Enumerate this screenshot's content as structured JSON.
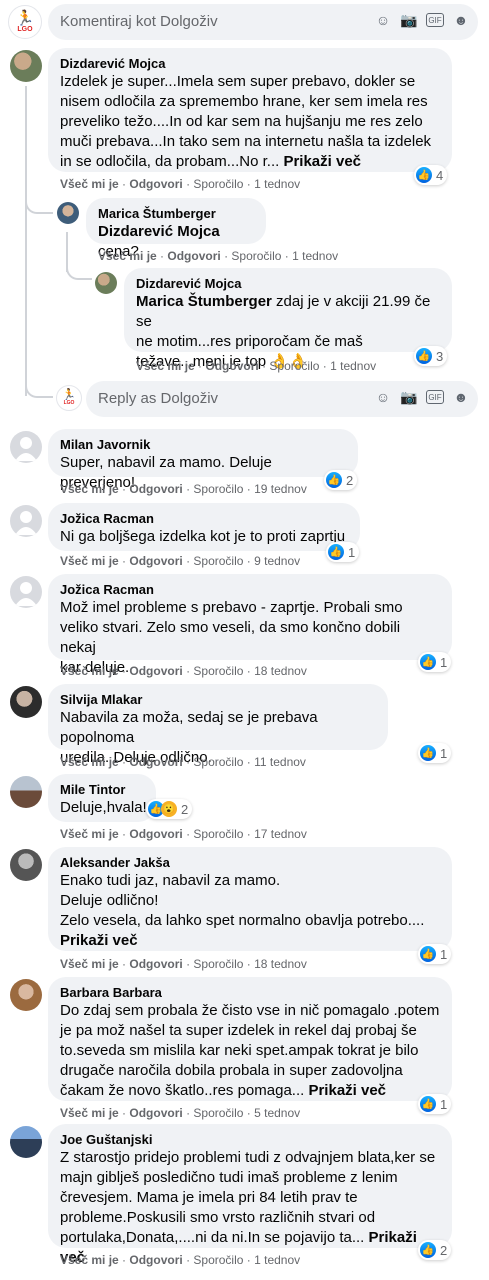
{
  "page_name": "Dolgoživ",
  "top_composer": {
    "placeholder": "Komentiraj kot Dolgoživ"
  },
  "reply_composer": {
    "placeholder": "Reply as Dolgoživ"
  },
  "logo": {
    "text": "LGO"
  },
  "actions": {
    "like": "Všeč mi je",
    "reply": "Odgovori",
    "message": "Sporočilo",
    "sep": " · "
  },
  "more_label": "Prikaži več",
  "comments": [
    {
      "name": "Dizdarević Mojca",
      "lines": [
        "Izdelek je super...Imela sem super prebavo, dokler se",
        "nisem odločila za spremembo hrane, ker sem imela res",
        "preveliko težo....In od kar sem na hujšanju me res zelo",
        "muči prebava...In tako sem na internetu našla ta izdelek",
        "in se odločila, da probam...No r..."
      ],
      "more": true,
      "time": "1 tednov",
      "reactions": "4"
    },
    {
      "name": "Marica Štumberger",
      "mention": "Dizdarević Mojca",
      "lines": [
        " cena?"
      ],
      "time": "1 tednov",
      "reactions": ""
    },
    {
      "name": "Dizdarević Mojca",
      "mention": "Marica Štumberger",
      "lines": [
        " zdaj je v akciji 21.99 če se",
        "ne motim...res priporočam če maš",
        "težave...meni je top 👌👌"
      ],
      "time": "1 tednov",
      "reactions": "3"
    },
    {
      "name": "Milan Javornik",
      "lines": [
        "Super, nabavil za mamo. Deluje preverjeno!"
      ],
      "time": "19 tednov",
      "reactions": "2"
    },
    {
      "name": "Jožica Racman",
      "lines": [
        "Ni ga boljšega izdelka kot je to proti zaprtju"
      ],
      "time": "9 tednov",
      "reactions": "1"
    },
    {
      "name": "Jožica Racman",
      "lines": [
        "Mož imel probleme s prebavo - zaprtje. Probali smo",
        "veliko stvari. Zelo smo veseli, da smo končno dobili nekaj",
        "kar deluje."
      ],
      "time": "18 tednov",
      "reactions": "1"
    },
    {
      "name": "Silvija Mlakar",
      "lines": [
        "Nabavila za moža, sedaj se je prebava popolnoma",
        "uredila. Deluje odlično."
      ],
      "time": "11 tednov",
      "reactions": "1"
    },
    {
      "name": "Mile Tintor",
      "lines": [
        "Deluje,hvala!"
      ],
      "time": "17 tednov",
      "reactions": "2"
    },
    {
      "name": "Aleksander Jakša",
      "lines": [
        "Enako tudi jaz, nabavil za mamo.",
        "Deluje odlično!",
        "Zelo vesela, da lahko spet normalno obavlja potrebo...."
      ],
      "more_line": true,
      "time": "18 tednov",
      "reactions": "1"
    },
    {
      "name": "Barbara Barbara",
      "lines": [
        "Do zdaj sem probala že čisto vse in nič pomagalo .potem",
        "je pa mož našel ta super izdelek in rekel daj probaj še",
        "to.seveda sm mislila kar neki spet.ampak tokrat je bilo",
        "drugače naročila dobila probala in super zadovoljna",
        "čakam že novo škatlo..res pomaga..."
      ],
      "more": true,
      "time": "5 tednov",
      "reactions": "1"
    },
    {
      "name": "Joe Guštanjski",
      "lines": [
        "Z starostjo pridejo problemi tudi z odvajnjem blata,ker se",
        "majn giblješ posledično tudi imaš probleme z lenim",
        "črevesjem. Mama je imela pri 84 letih prav te",
        "probleme.Poskusili smo vrsto različnih stvari od",
        "portulaka,Donata,....ni da ni.In se pojavijo ta..."
      ],
      "more": true,
      "time": "1 tednov",
      "reactions": "2"
    }
  ]
}
